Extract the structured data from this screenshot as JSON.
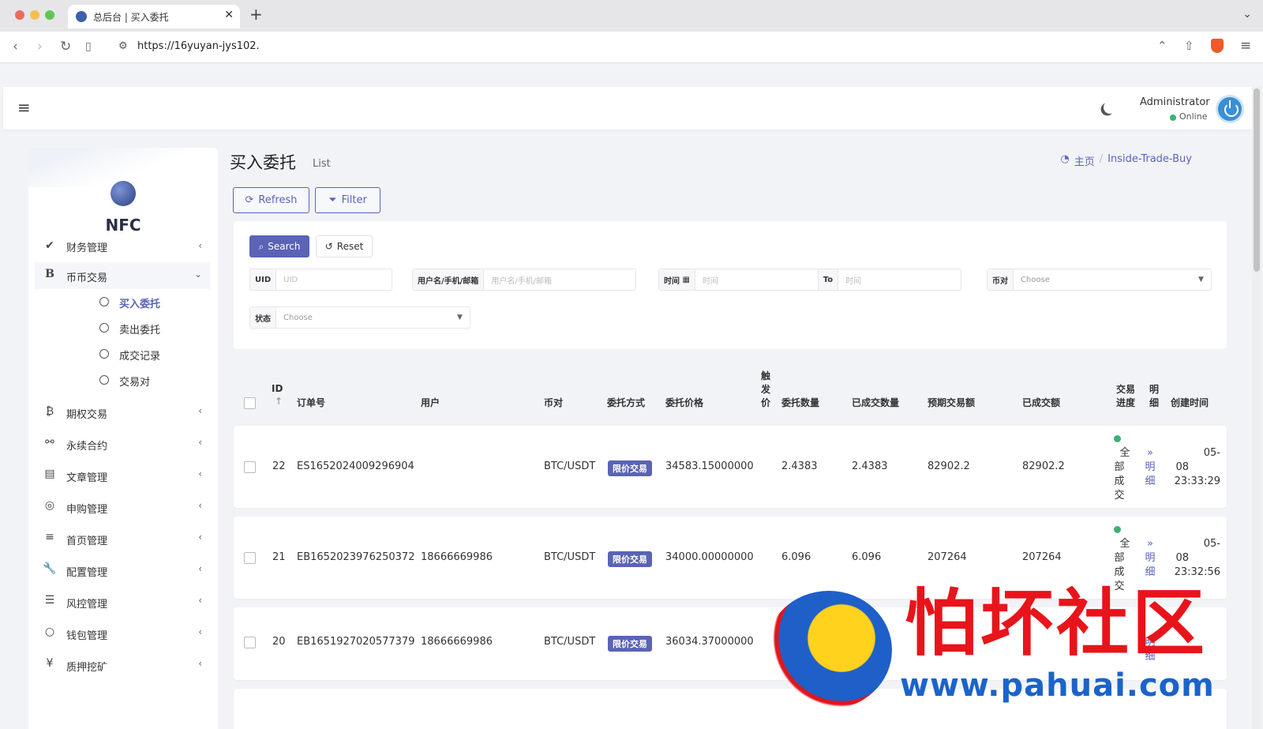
{
  "browser": {
    "tab_title": "总后台 | 买入委托",
    "url": "https://16yuyan-jys102."
  },
  "header": {
    "admin_name": "Administrator",
    "status": "Online"
  },
  "sidebar": {
    "brand": "NFC",
    "partial_item": "财务管理",
    "open_item": {
      "icon": "B",
      "label": "币币交易"
    },
    "sub_items": [
      "买入委托",
      "卖出委托",
      "成交记录",
      "交易对"
    ],
    "items": [
      {
        "icon": "₿",
        "label": "期权交易",
        "icon_name": "bitcoin-icon"
      },
      {
        "icon": "⚯",
        "label": "永续合约",
        "icon_name": "link-icon"
      },
      {
        "icon": "▤",
        "label": "文章管理",
        "icon_name": "newspaper-icon"
      },
      {
        "icon": "◎",
        "label": "申购管理",
        "icon_name": "lifebuoy-icon"
      },
      {
        "icon": "≡",
        "label": "首页管理",
        "icon_name": "list-icon"
      },
      {
        "icon": "🔧",
        "label": "配置管理",
        "icon_name": "wrench-icon"
      },
      {
        "icon": "☰",
        "label": "风控管理",
        "icon_name": "list-ul-icon"
      },
      {
        "icon": "○",
        "label": "钱包管理",
        "icon_name": "circle-icon"
      },
      {
        "icon": "¥",
        "label": "质押挖矿",
        "icon_name": "yen-icon"
      }
    ]
  },
  "page": {
    "title": "买入委托",
    "subtitle": "List",
    "breadcrumb_home": "主页",
    "breadcrumb_current": "Inside-Trade-Buy",
    "refresh_label": "Refresh",
    "filter_label": "Filter"
  },
  "filters": {
    "search_label": "Search",
    "reset_label": "Reset",
    "uid_label": "UID",
    "uid_placeholder": "UID",
    "user_label": "用户名/手机/邮箱",
    "user_placeholder": "用户名/手机/邮箱",
    "time_label": "时间",
    "time_placeholder": "时间",
    "to_label": "To",
    "pair_label": "币对",
    "pair_value": "Choose",
    "status_label": "状态",
    "status_value": "Choose"
  },
  "table": {
    "headers": {
      "id": "ID",
      "order_no": "订单号",
      "user": "用户",
      "pair": "币对",
      "method": "委托方式",
      "price": "委托价格",
      "trigger": [
        "触",
        "发",
        "价"
      ],
      "quantity": "委托数量",
      "filled_qty": "已成交数量",
      "expected_amt": "预期交易额",
      "filled_amt": "已成交额",
      "progress": [
        "交易",
        "进度"
      ],
      "detail": [
        "明",
        "细"
      ],
      "created": "创建时间"
    },
    "rows": [
      {
        "id": "22",
        "order_no": "ES1652024009296904",
        "user": "",
        "pair": "BTC/USDT",
        "method": "限价交易",
        "price": "34583.15000000",
        "quantity": "2.4383",
        "filled_qty": "2.4383",
        "expected_amt": "82902.2",
        "filled_amt": "82902.2",
        "progress": [
          "全",
          "部",
          "成",
          "交"
        ],
        "detail": [
          "»",
          "明",
          "细"
        ],
        "created": [
          "05-",
          "08",
          "23:33:29"
        ]
      },
      {
        "id": "21",
        "order_no": "EB1652023976250372",
        "user": "18666669986",
        "pair": "BTC/USDT",
        "method": "限价交易",
        "price": "34000.00000000",
        "quantity": "6.096",
        "filled_qty": "6.096",
        "expected_amt": "207264",
        "filled_amt": "207264",
        "progress": [
          "全",
          "部",
          "成",
          "交"
        ],
        "detail": [
          "»",
          "明",
          "细"
        ],
        "created": [
          "05-",
          "08",
          "23:32:56"
        ]
      },
      {
        "id": "20",
        "order_no": "EB1651927020577379",
        "user": "18666669986",
        "pair": "BTC/USDT",
        "method": "限价交易",
        "price": "36034.37000000",
        "detail": [
          "明",
          "细"
        ]
      }
    ]
  },
  "watermark": {
    "title": "怕坏社区",
    "url": "www.pahuai.com"
  }
}
